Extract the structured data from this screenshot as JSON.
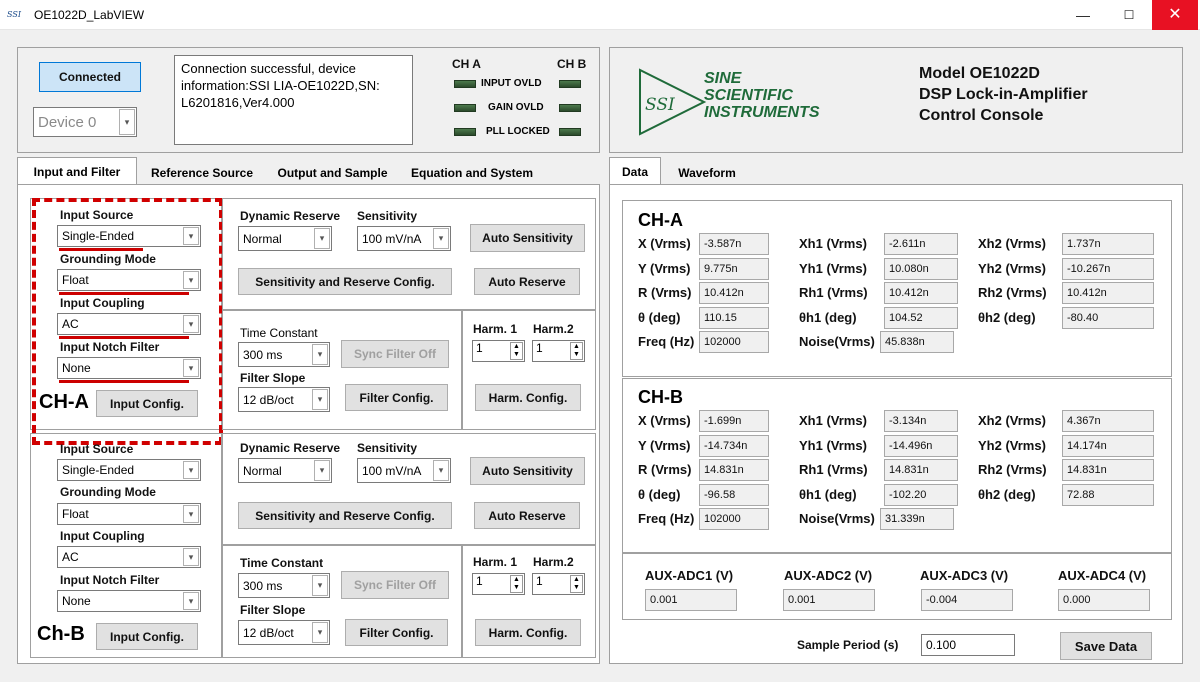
{
  "window": {
    "logo": "SSI",
    "title": "OE1022D_LabVIEW",
    "minimize": "—",
    "maximize": "☐",
    "close": "✕"
  },
  "header": {
    "connect_label": "Connected",
    "device_value": "Device 0",
    "status_message": "Connection successful, device information:SSI LIA-OE1022D,SN: L6201816,Ver4.000",
    "cha": "CH A",
    "chb": "CH B",
    "leds": [
      "INPUT OVLD",
      "GAIN OVLD",
      "PLL LOCKED"
    ],
    "brand_abbr": "SSI",
    "brand_lines": [
      "SINE",
      "SCIENTIFIC",
      "INSTRUMENTS"
    ],
    "model_lines": [
      "Model OE1022D",
      "DSP Lock-in-Amplifier",
      "Control Console"
    ]
  },
  "left_tabs": [
    "Input and Filter",
    "Reference Source",
    "Output and Sample",
    "Equation and System"
  ],
  "right_tabs": [
    "Data",
    "Waveform"
  ],
  "channels": [
    {
      "name": "CH-A",
      "input_source_label": "Input Source",
      "input_source": "Single-Ended",
      "grounding_label": "Grounding Mode",
      "grounding": "Float",
      "coupling_label": "Input Coupling",
      "coupling": "AC",
      "notch_label": "Input Notch Filter",
      "notch": "None",
      "input_config": "Input Config.",
      "dyn_reserve_label": "Dynamic Reserve",
      "dyn_reserve": "Normal",
      "sensitivity_label": "Sensitivity",
      "sensitivity": "100 mV/nA",
      "auto_sensitivity": "Auto Sensitivity",
      "sens_config": "Sensitivity and Reserve Config.",
      "auto_reserve": "Auto Reserve",
      "tc_label": "Time Constant",
      "tc": "300 ms",
      "sync_filter": "Sync Filter Off",
      "slope_label": "Filter Slope",
      "slope": "12 dB/oct",
      "filter_config": "Filter Config.",
      "harm1_label": "Harm. 1",
      "harm2_label": "Harm.2",
      "harm1": "1",
      "harm2": "1",
      "harm_config": "Harm.  Config."
    },
    {
      "name": "Ch-B",
      "input_source_label": "Input Source",
      "input_source": "Single-Ended",
      "grounding_label": "Grounding Mode",
      "grounding": "Float",
      "coupling_label": "Input Coupling",
      "coupling": "AC",
      "notch_label": "Input Notch Filter",
      "notch": "None",
      "input_config": "Input Config.",
      "dyn_reserve_label": "Dynamic Reserve",
      "dyn_reserve": "Normal",
      "sensitivity_label": "Sensitivity",
      "sensitivity": "100 mV/nA",
      "auto_sensitivity": "Auto Sensitivity",
      "sens_config": "Sensitivity and Reserve Config.",
      "auto_reserve": "Auto Reserve",
      "tc_label": "Time Constant",
      "tc": "300 ms",
      "sync_filter": "Sync Filter Off",
      "slope_label": "Filter Slope",
      "slope": "12 dB/oct",
      "filter_config": "Filter Config.",
      "harm1_label": "Harm. 1",
      "harm2_label": "Harm.2",
      "harm1": "1",
      "harm2": "1",
      "harm_config": "Harm.  Config."
    }
  ],
  "data": {
    "cha": {
      "title": "CH-A",
      "rows": [
        [
          [
            "X (Vrms)",
            "-3.587n"
          ],
          [
            "Xh1 (Vrms)",
            "-2.611n"
          ],
          [
            "Xh2 (Vrms)",
            "1.737n"
          ]
        ],
        [
          [
            "Y (Vrms)",
            "9.775n"
          ],
          [
            "Yh1 (Vrms)",
            "10.080n"
          ],
          [
            "Yh2 (Vrms)",
            "-10.267n"
          ]
        ],
        [
          [
            "R (Vrms)",
            "10.412n"
          ],
          [
            "Rh1 (Vrms)",
            "10.412n"
          ],
          [
            "Rh2 (Vrms)",
            "10.412n"
          ]
        ],
        [
          [
            "θ  (deg)",
            "110.15"
          ],
          [
            "θh1  (deg)",
            "104.52"
          ],
          [
            "θh2  (deg)",
            "-80.40"
          ]
        ],
        [
          [
            "Freq (Hz)",
            "102000"
          ],
          [
            "Noise(Vrms)",
            "45.838n"
          ]
        ]
      ]
    },
    "chb": {
      "title": "CH-B",
      "rows": [
        [
          [
            "X (Vrms)",
            "-1.699n"
          ],
          [
            "Xh1 (Vrms)",
            "-3.134n"
          ],
          [
            "Xh2 (Vrms)",
            "4.367n"
          ]
        ],
        [
          [
            "Y (Vrms)",
            "-14.734n"
          ],
          [
            "Yh1 (Vrms)",
            "-14.496n"
          ],
          [
            "Yh2 (Vrms)",
            "14.174n"
          ]
        ],
        [
          [
            "R (Vrms)",
            "14.831n"
          ],
          [
            "Rh1 (Vrms)",
            "14.831n"
          ],
          [
            "Rh2 (Vrms)",
            "14.831n"
          ]
        ],
        [
          [
            "θ  (deg)",
            "-96.58"
          ],
          [
            "θh1  (deg)",
            "-102.20"
          ],
          [
            "θh2  (deg)",
            "72.88"
          ]
        ],
        [
          [
            "Freq (Hz)",
            "102000"
          ],
          [
            "Noise(Vrms)",
            "31.339n"
          ]
        ]
      ]
    },
    "aux": [
      [
        "AUX-ADC1 (V)",
        "0.001"
      ],
      [
        "AUX-ADC2 (V)",
        "0.001"
      ],
      [
        "AUX-ADC3 (V)",
        "-0.004"
      ],
      [
        "AUX-ADC4 (V)",
        "0.000"
      ]
    ],
    "sample_period_label": "Sample Period (s)",
    "sample_period": "0.100",
    "save_data": "Save Data"
  },
  "colors": {
    "highlight_red": "#cc0000",
    "connected_bg": "#cce4f7",
    "brand_green": "#1f6b3a"
  }
}
